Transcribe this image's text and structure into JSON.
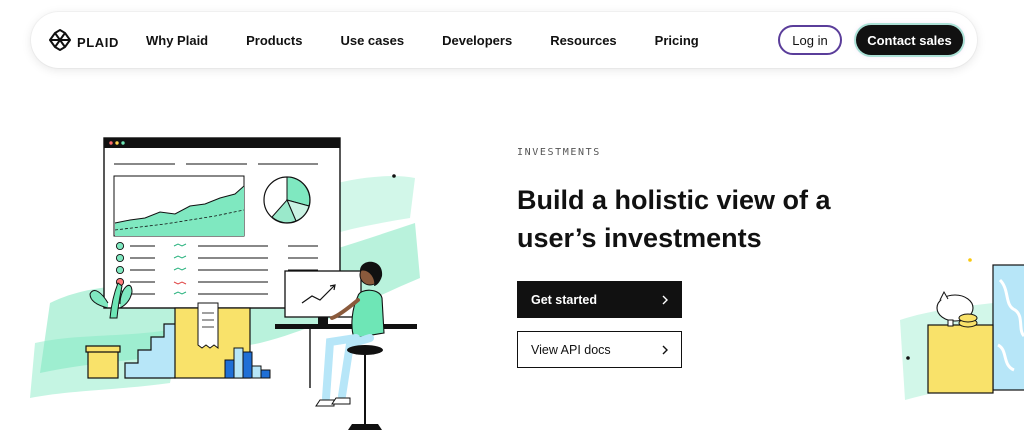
{
  "nav": {
    "logo_text": "PLAID",
    "links": [
      "Why Plaid",
      "Products",
      "Use cases",
      "Developers",
      "Resources",
      "Pricing"
    ],
    "login_label": "Log in",
    "contact_label": "Contact sales"
  },
  "hero": {
    "eyebrow": "INVESTMENTS",
    "headline": "Build a holistic view of a user’s investments",
    "primary_cta": "Get started",
    "secondary_cta": "View API docs"
  },
  "colors": {
    "brand_dark": "#111111",
    "accent_mint": "#6ee6b6",
    "accent_yellow": "#f9e26a",
    "accent_blue": "#1f6fd6",
    "login_border": "#5a3d9a"
  },
  "icons": [
    "plaid-logo-icon",
    "chevron-right-icon"
  ]
}
